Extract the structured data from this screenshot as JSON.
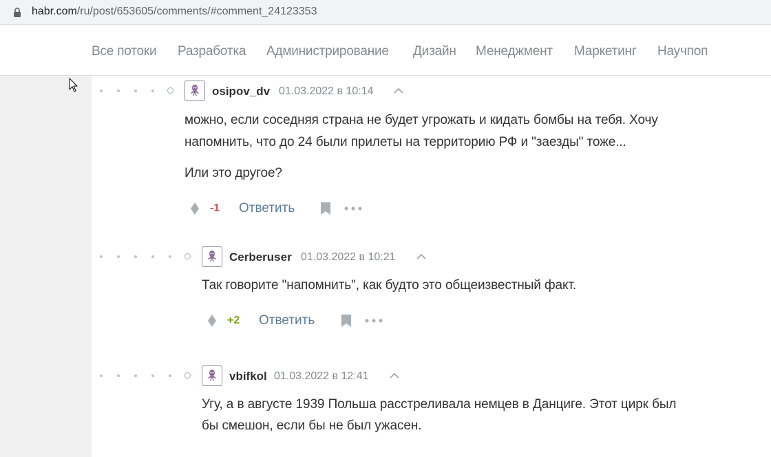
{
  "browser": {
    "url_host": "habr.com",
    "url_path": "/ru/post/653605/comments/#comment_24123353"
  },
  "nav": {
    "items": [
      {
        "label": "Все потоки"
      },
      {
        "label": "Разработка"
      },
      {
        "label": "Администрирование"
      },
      {
        "label": "Дизайн"
      },
      {
        "label": "Менеджмент"
      },
      {
        "label": "Маркетинг"
      },
      {
        "label": "Научпоп"
      }
    ]
  },
  "comments": [
    {
      "author": "osipov_dv",
      "date": "01.03.2022 в 10:14",
      "lines": [
        "можно, если соседняя страна не будет угрожать и кидать бомбы на тебя. Хочу",
        "напомнить, что до 24 были прилеты на территорию РФ и \"заезды\" тоже...",
        "Или это другое?"
      ],
      "score": "-1",
      "reply_label": "Ответить"
    },
    {
      "author": "Cerberuser",
      "date": "01.03.2022 в 10:21",
      "lines": [
        "Так говорите \"напомнить\", как будто это общеизвестный факт."
      ],
      "score": "+2",
      "reply_label": "Ответить"
    },
    {
      "author": "vbifkol",
      "date": "01.03.2022 в 12:41",
      "lines": [
        "Угу, а в августе 1939 Польша расстреливала немцев в Данциге. Этот цирк был",
        "бы смешон, если бы не был ужасен."
      ]
    }
  ],
  "colors": {
    "score_negative": "#d04e4e",
    "score_positive": "#7da01e",
    "reply_link": "#5e7d96",
    "avatar_border": "#9a86a3"
  }
}
